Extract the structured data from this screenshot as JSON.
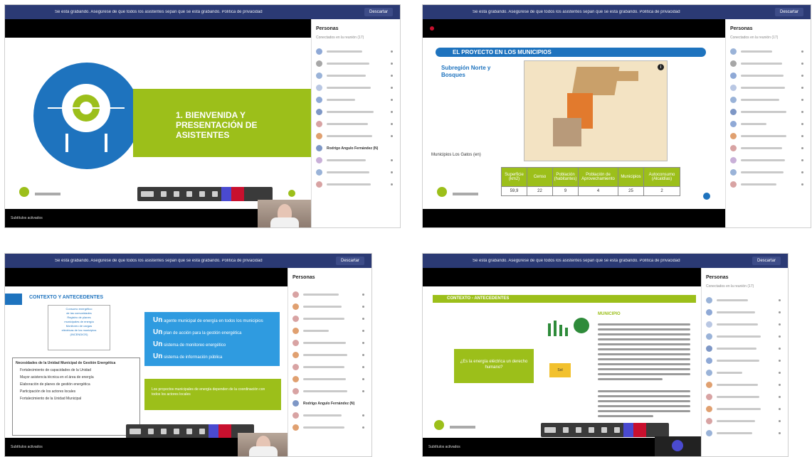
{
  "shots": {
    "s1": {
      "topbar_msg": "Se está grabando. Asegúrese de que todos los asistentes sepan que se está grabando. Política de privacidad",
      "topbar_btn": "Descartar",
      "slide_title": "1. BIENVENIDA Y PRESENTACIÓN DE ASISTENTES",
      "panel_title": "Personas",
      "panel_sub": "Conectados en la reunión (17)",
      "highlight_name": "Rodrigo Angulo Fernández (N)",
      "bottom_text": "Subtítulos activados"
    },
    "s2": {
      "slide_header": "EL PROYECTO EN LOS MUNICIPIOS",
      "subtitle": "Subregión Norte y Bosques",
      "map_caption": "Municipios Los Gatos (en)",
      "table_headers": [
        "Superficie (km2)",
        "Censo",
        "Población (habitantes)",
        "Población de Aprovechamiento",
        "Municipios",
        "Autoconsumo (Alcaldías)"
      ],
      "table_values": [
        "59,9",
        "22",
        "9",
        "4",
        "25",
        "2"
      ],
      "panel_title": "Personas",
      "panel_sub": "Conectados en la reunión (17)"
    },
    "s3": {
      "slide_header": "CONTEXTO Y ANTECEDENTES",
      "box_lines": [
        "Consumo energético",
        "de las comunidades",
        "Registro de planes",
        "municipales de energía",
        "Monitoreo de cargas",
        "eléctricas de los municipios",
        "(INCENDIOS)"
      ],
      "bullets": [
        {
          "lead": "Un",
          "text": "agente municipal de energía en todos los municipios"
        },
        {
          "lead": "Un",
          "text": "plan de acción para la gestión energética"
        },
        {
          "lead": "Un",
          "text": "sistema de monitoreo energético"
        },
        {
          "lead": "Un",
          "text": "sistema de información pública"
        }
      ],
      "green_text": "Los proyectos municipales de energía dependen de la coordinación con todos los actores locales",
      "list_title": "Necesidades de la Unidad Municipal de Gestión Energética",
      "list_items": [
        "Fortalecimiento de capacidades de la Unidad",
        "Mayor asistencia técnica en el área de energía",
        "Elaboración de planes de gestión energética",
        "Participación de los actores locales",
        "Fortalecimiento de la Unidad Municipal"
      ],
      "panel_title": "Personas",
      "highlight_name": "Rodrigo Angulo Fernández (N)",
      "bottom_text": "Subtítulos activados"
    },
    "s4": {
      "slide_header": "CONTEXTO - ANTECEDENTES",
      "green_box": "¿Es la energía eléctrica un derecho humano?",
      "heading": "MUNICIPIO",
      "paragraph_lines": 14,
      "yellow_badge": "Sol",
      "panel_title": "Personas",
      "panel_sub": "Conectados en la reunión (17)",
      "bottom_text": "Subtítulos activados"
    }
  },
  "colors": {
    "teams_topbar": "#2b3a74",
    "slide_green": "#9cbf1a",
    "slide_blue": "#1e73be",
    "end_call_red": "#c8102e"
  }
}
